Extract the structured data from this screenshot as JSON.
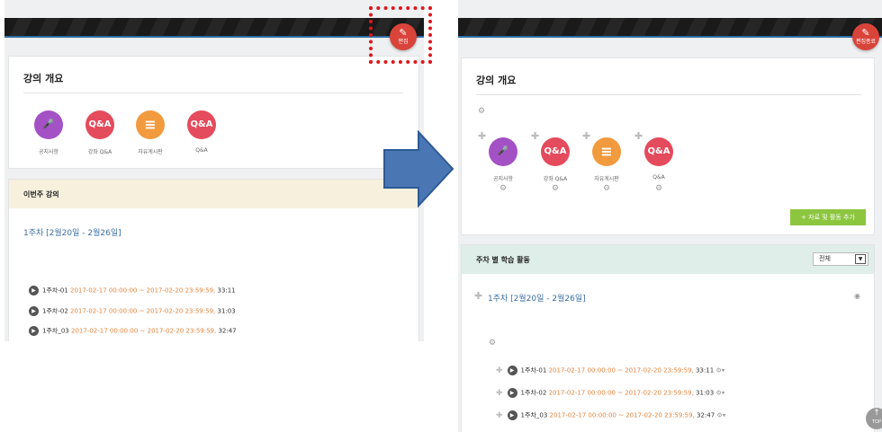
{
  "before": {
    "edit_button": "편집",
    "overview": {
      "title": "강의 개요",
      "icons": [
        {
          "label": "공지사항",
          "text": "",
          "icon": "microphone-icon",
          "color": "#a351c5"
        },
        {
          "label": "강좌 Q&A",
          "text": "Q&A",
          "icon": "qa-icon",
          "color": "#e44b5c"
        },
        {
          "label": "자유게시판",
          "text": "≡",
          "icon": "list-icon",
          "color": "#f19a3e"
        },
        {
          "label": "Q&A",
          "text": "Q&A",
          "icon": "qa-icon",
          "color": "#e44b5c"
        }
      ]
    },
    "week_section": {
      "title": "이번주 강의",
      "week_link": "1주차 [2월20일 - 2월26일]",
      "lectures": [
        {
          "name": "1주차-01",
          "date": "2017-02-17 00:00:00 ~ 2017-02-20 23:59:59,",
          "duration": "33:11"
        },
        {
          "name": "1주차-02",
          "date": "2017-02-17 00:00:00 ~ 2017-02-20 23:59:59,",
          "duration": "31:03"
        },
        {
          "name": "1주차_03",
          "date": "2017-02-17 00:00:00 ~ 2017-02-20 23:59:59,",
          "duration": "32:47"
        }
      ]
    }
  },
  "after": {
    "edit_done_button": "편집종료",
    "overview": {
      "title": "강의 개요",
      "icons": [
        {
          "label": "공지사항",
          "text": "",
          "icon": "microphone-icon",
          "color": "#a351c5"
        },
        {
          "label": "강좌 Q&A",
          "text": "Q&A",
          "icon": "qa-icon",
          "color": "#e44b5c"
        },
        {
          "label": "자유게시판",
          "text": "≡",
          "icon": "list-icon",
          "color": "#f19a3e"
        },
        {
          "label": "Q&A",
          "text": "Q&A",
          "icon": "qa-icon",
          "color": "#e44b5c"
        }
      ],
      "add_button": "+ 자료 및 활동 추가"
    },
    "week_section": {
      "title": "주차 별 학습 활동",
      "filter_value": "전체",
      "week_link": "1주차 [2월20일 - 2월26일]",
      "lectures": [
        {
          "name": "1주차-01",
          "date": "2017-02-17 00:00:00 ~ 2017-02-20 23:59:59,",
          "duration": "33:11"
        },
        {
          "name": "1주차-02",
          "date": "2017-02-17 00:00:00 ~ 2017-02-20 23:59:59,",
          "duration": "31:03"
        },
        {
          "name": "1주차_03",
          "date": "2017-02-17 00:00:00 ~ 2017-02-20 23:59:59,",
          "duration": "32:47"
        }
      ]
    },
    "top_button": "TOP"
  },
  "colors": {
    "accent_red": "#d9443a",
    "link_blue": "#3a6ea5",
    "date_orange": "#e4843e",
    "add_green": "#8cc63f"
  }
}
